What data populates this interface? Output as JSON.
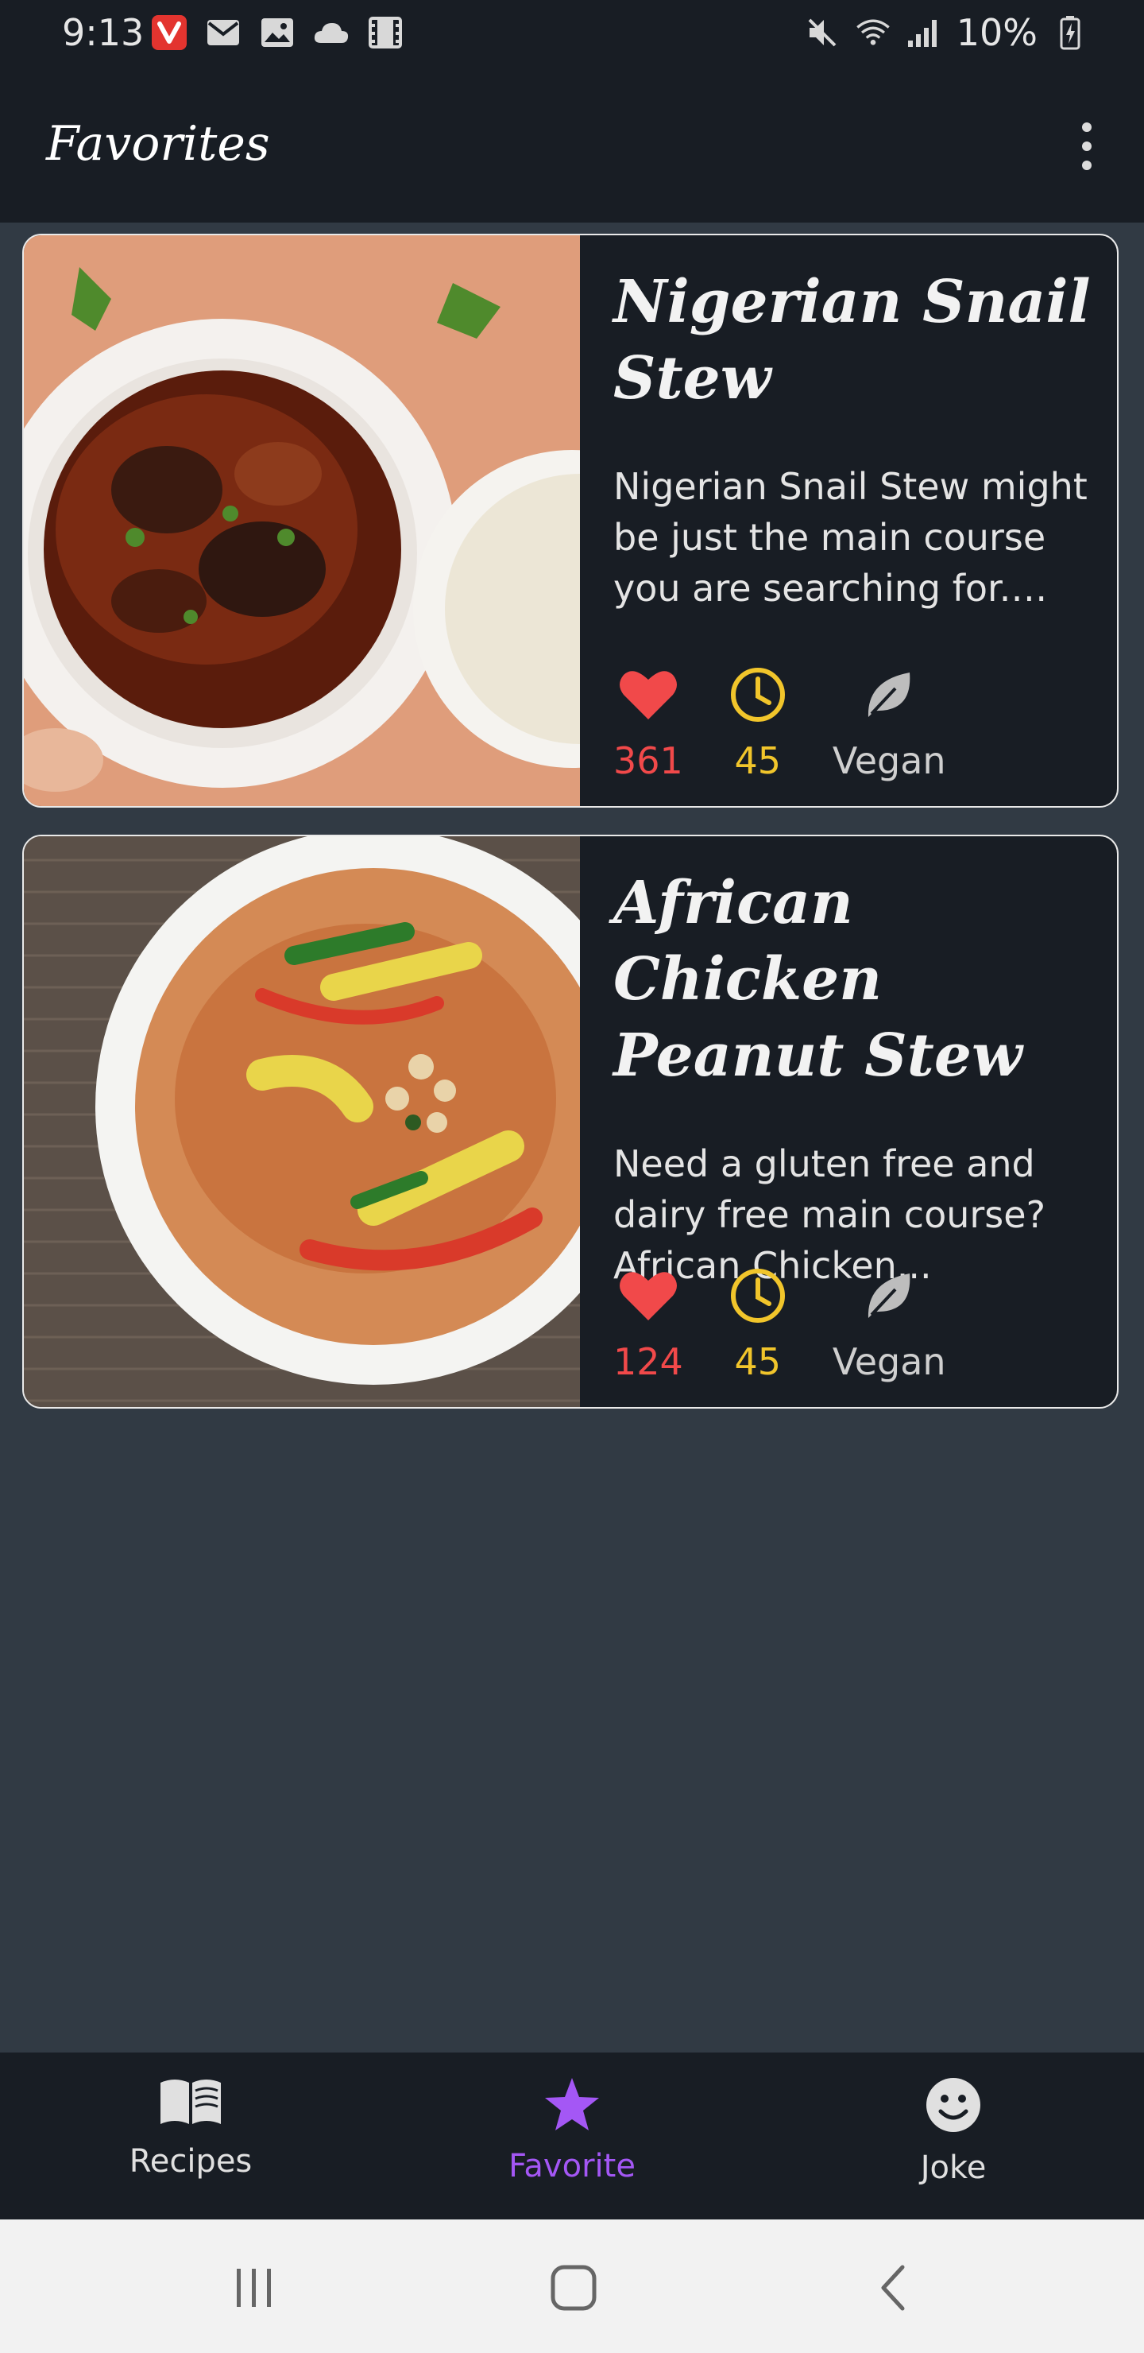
{
  "status_bar": {
    "time": "9:13",
    "battery": "10%"
  },
  "app_bar": {
    "title": "Favorites"
  },
  "recipes": [
    {
      "title": "Nigerian Snail Stew",
      "description": "Nigerian Snail Stew might be just the main course you are searching for. Fo...",
      "likes": "361",
      "minutes": "45",
      "diet": "Vegan"
    },
    {
      "title": "African Chicken Peanut Stew",
      "description": "Need a gluten free and dairy free main course? African Chicken...",
      "likes": "124",
      "minutes": "45",
      "diet": "Vegan"
    }
  ],
  "bottom_nav": {
    "items": [
      {
        "label": "Recipes",
        "icon": "book-icon",
        "active": false
      },
      {
        "label": "Favorite",
        "icon": "star-icon",
        "active": true
      },
      {
        "label": "Joke",
        "icon": "smiley-icon",
        "active": false
      }
    ]
  },
  "colors": {
    "background": "#313a44",
    "surface": "#181d24",
    "accent": "#a457f5",
    "likes": "#f1494a",
    "time": "#f1c52b"
  }
}
